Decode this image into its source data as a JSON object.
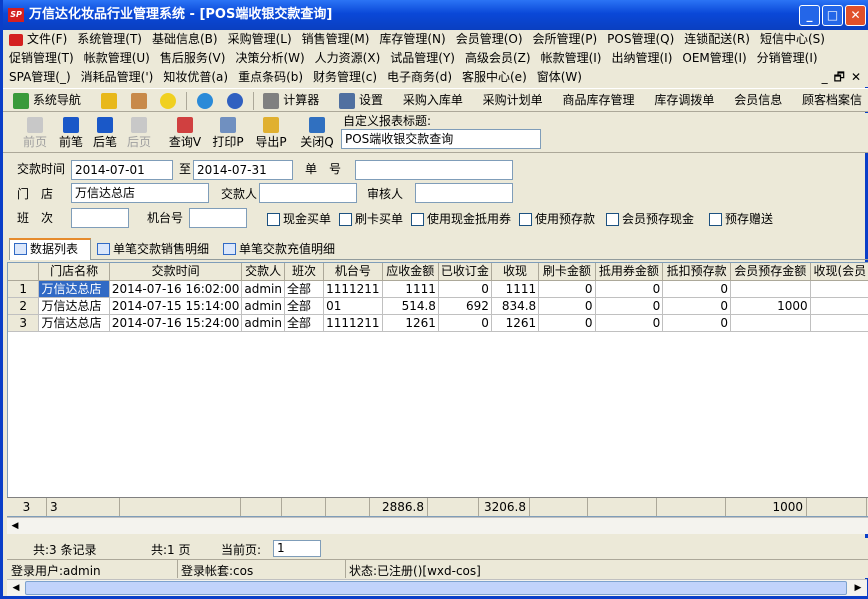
{
  "window": {
    "title": "万信达化妆品行业管理系统 - [POS端收银交款查询]",
    "icon_text": "SP",
    "min_glyph": "_",
    "max_glyph": "□",
    "close_glyph": "✕"
  },
  "menu_row1": [
    "文件(F)",
    "系统管理(T)",
    "基础信息(B)",
    "采购管理(L)",
    "销售管理(M)",
    "库存管理(N)",
    "会员管理(O)",
    "会所管理(P)",
    "POS管理(Q)",
    "连锁配送(R)",
    "短信中心(S)"
  ],
  "menu_row2": [
    "促销管理(T)",
    "帐款管理(U)",
    "售后服务(V)",
    "决策分析(W)",
    "人力资源(X)",
    "试品管理(Y)",
    "高级会员(Z)",
    "帐款管理(I)",
    "出纳管理(I)",
    "OEM管理(I)",
    "分销管理(I)"
  ],
  "menu_row3": [
    "SPA管理(_)",
    "消耗品管理(')",
    "知妆优普(a)",
    "重点条码(b)",
    "财务管理(c)",
    "电子商务(d)",
    "客服中心(e)",
    "窗体(W)"
  ],
  "mdi": {
    "min": "_",
    "restore": "🗗",
    "close": "✕"
  },
  "toolbar1": {
    "nav": "系统导航",
    "calc": "计算器",
    "settings": "设置",
    "items": [
      "采购入库单",
      "采购计划单",
      "商品库存管理",
      "库存调拨单",
      "会员信息",
      "顾客档案信"
    ]
  },
  "toolbar2": {
    "first": "前页",
    "prev": "前笔",
    "next": "后笔",
    "last": "后页",
    "query": "查询V",
    "print": "打印P",
    "export": "导出P",
    "close": "关闭Q",
    "custom_title_label": "自定义报表标题:",
    "custom_title_value": "POS端收银交款查询"
  },
  "form": {
    "pay_time_label": "交款时间",
    "date_from": "2014-07-01",
    "to_label": "至",
    "date_to": "2014-07-31",
    "doc_no_label": "单　号",
    "doc_no": "",
    "store_label": "门　店",
    "store": "万信达总店",
    "payer_label": "交款人",
    "payer": "",
    "auditor_label": "审核人",
    "auditor": "",
    "shift_label": "班　次",
    "shift": "",
    "pos_label": "机台号",
    "pos": "",
    "checks": [
      "现金买单",
      "刷卡买单",
      "使用现金抵用券",
      "使用预存款",
      "会员预存现金",
      "预存赠送"
    ]
  },
  "tabs": [
    "数据列表",
    "单笔交款销售明细",
    "单笔交款充值明细"
  ],
  "table": {
    "headers": [
      "",
      "门店名称",
      "交款时间",
      "交款人",
      "班次",
      "机台号",
      "应收金额",
      "已收订金",
      "收现",
      "刷卡金额",
      "抵用券金额",
      "抵扣预存款",
      "会员预存金额",
      "收现(会员"
    ],
    "rows": [
      [
        "1",
        "万信达总店",
        "2014-07-16 16:02:00",
        "admin",
        "全部",
        "1111211",
        "1111",
        "0",
        "1111",
        "0",
        "0",
        "0",
        "",
        ""
      ],
      [
        "2",
        "万信达总店",
        "2014-07-15 15:14:00",
        "admin",
        "全部",
        "01",
        "514.8",
        "692",
        "834.8",
        "0",
        "0",
        "0",
        "1000",
        ""
      ],
      [
        "3",
        "万信达总店",
        "2014-07-16 15:24:00",
        "admin",
        "全部",
        "1111211",
        "1261",
        "0",
        "1261",
        "0",
        "0",
        "0",
        "",
        ""
      ]
    ],
    "footer": [
      "3",
      "3",
      "",
      "",
      "",
      "",
      "2886.8",
      "",
      "3206.8",
      "",
      "",
      "",
      "1000",
      ""
    ]
  },
  "status": {
    "records": "共:3 条记录",
    "pages": "共:1 页",
    "current_label": "当前页:",
    "current_page": "1",
    "user_label": "登录用户:admin",
    "account_label": "登录帐套:cos",
    "state_label": "状态:已注册()[wxd-cos]"
  }
}
